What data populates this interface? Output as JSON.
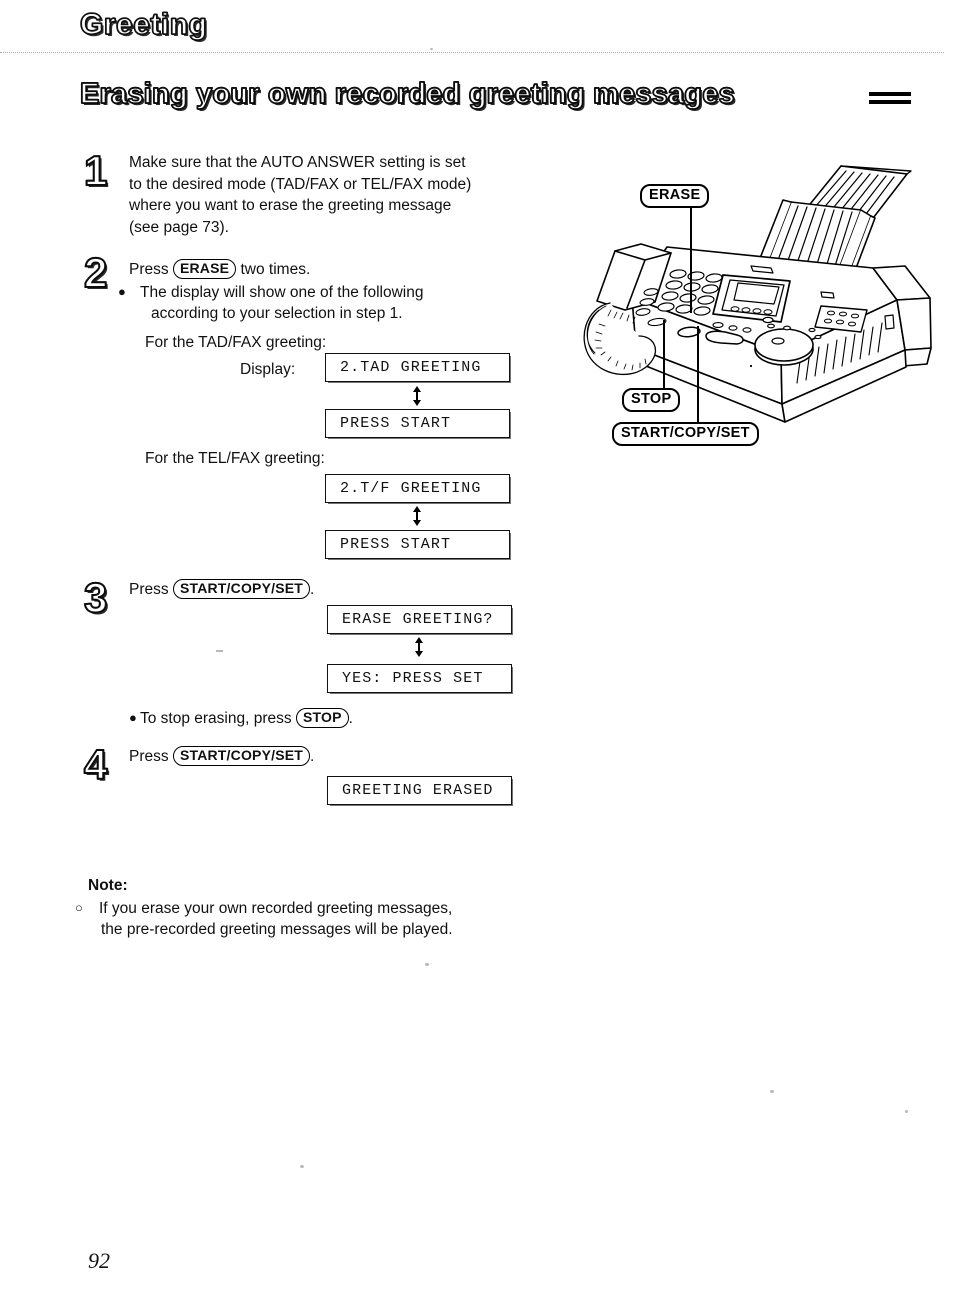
{
  "document": {
    "section_title": "Greeting",
    "page_heading": "Erasing your own recorded greeting messages",
    "page_number": "92"
  },
  "steps": [
    {
      "number": "1",
      "lines": [
        "Make sure that the AUTO ANSWER setting is set",
        "to the desired mode (TAD/FAX or TEL/FAX mode)",
        "where you want to erase the greeting message",
        "(see page 73)."
      ]
    },
    {
      "number": "2",
      "press_prefix": "Press",
      "key": "ERASE",
      "press_suffix": "two times.",
      "bullet_lines": [
        "The display will show one of the following",
        "according to your selection in step 1."
      ]
    },
    {
      "number": "3",
      "press_prefix": "Press",
      "key": "START/COPY/SET",
      "press_suffix": ".",
      "stop_note_prefix": "To stop erasing, press",
      "stop_note_key": "STOP",
      "stop_note_suffix": "."
    },
    {
      "number": "4",
      "press_prefix": "Press",
      "key": "START/COPY/SET",
      "press_suffix": "."
    }
  ],
  "display_groups": [
    {
      "caption": "For the TAD/FAX greeting:",
      "label": "Display:",
      "screens": [
        "2.TAD GREETING",
        "PRESS START"
      ]
    },
    {
      "caption": "For the TEL/FAX greeting:",
      "label": "",
      "screens": [
        "2.T/F GREETING",
        "PRESS START"
      ]
    },
    {
      "caption": "",
      "label": "",
      "screens": [
        "ERASE GREETING?",
        "YES: PRESS SET"
      ]
    },
    {
      "caption": "",
      "label": "",
      "screens": [
        "GREETING ERASED"
      ]
    }
  ],
  "note": {
    "title": "Note:",
    "lines": [
      "If you erase your own recorded greeting messages,",
      "the pre-recorded greeting messages will be played."
    ]
  },
  "illustration": {
    "alt": "fax-machine-line-drawing",
    "callouts": [
      {
        "label": "ERASE"
      },
      {
        "label": "STOP"
      },
      {
        "label": "START/COPY/SET"
      }
    ]
  }
}
